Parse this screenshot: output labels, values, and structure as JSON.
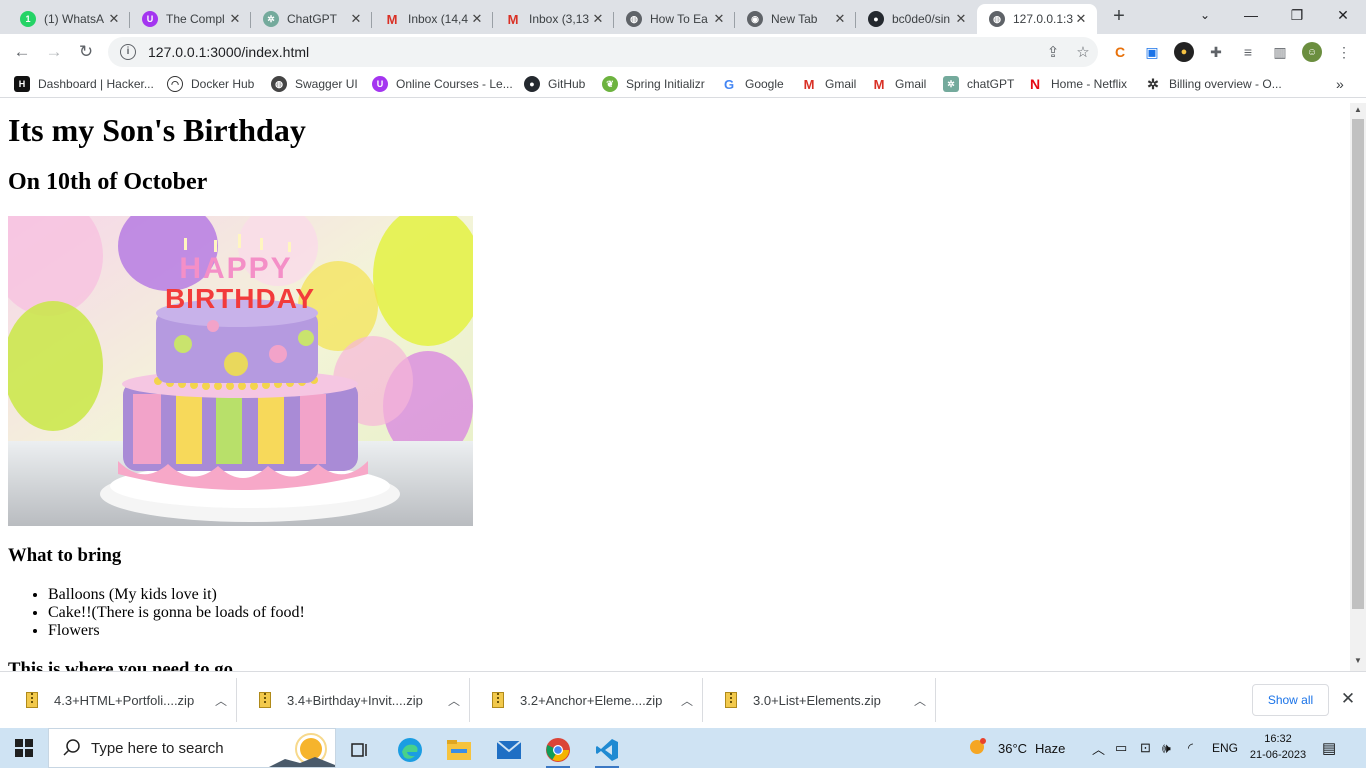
{
  "browser": {
    "tabs": [
      {
        "title": "(1) WhatsA",
        "icon": "whatsapp-icon"
      },
      {
        "title": "The Compl",
        "icon": "udemy-icon"
      },
      {
        "title": "ChatGPT",
        "icon": "openai-icon"
      },
      {
        "title": "Inbox (14,4",
        "icon": "gmail-icon"
      },
      {
        "title": "Inbox (3,13",
        "icon": "gmail-icon"
      },
      {
        "title": "How To Ea",
        "icon": "globe-icon"
      },
      {
        "title": "New Tab",
        "icon": "chrome-icon"
      },
      {
        "title": "bc0de0/sin",
        "icon": "github-icon"
      },
      {
        "title": "127.0.0.1:3",
        "icon": "globe-icon"
      }
    ],
    "address": "127.0.0.1:3000/index.html",
    "bookmarks": [
      {
        "label": "Dashboard | Hacker...",
        "icon": "hackerrank-icon"
      },
      {
        "label": "Docker Hub",
        "icon": "docker-icon"
      },
      {
        "label": "Swagger UI",
        "icon": "swagger-icon"
      },
      {
        "label": "Online Courses - Le...",
        "icon": "udemy-icon"
      },
      {
        "label": "GitHub",
        "icon": "github-icon"
      },
      {
        "label": "Spring Initializr",
        "icon": "spring-icon"
      },
      {
        "label": "Google",
        "icon": "google-icon"
      },
      {
        "label": "Gmail",
        "icon": "gmail-icon"
      },
      {
        "label": "Gmail",
        "icon": "gmail-icon"
      },
      {
        "label": "chatGPT",
        "icon": "openai-icon"
      },
      {
        "label": "Home - Netflix",
        "icon": "netflix-icon"
      },
      {
        "label": "Billing overview - O...",
        "icon": "openai-icon"
      }
    ]
  },
  "page": {
    "title": "Its my Son's Birthday",
    "date": "On 10th of October",
    "cake_text_top": "HAPPY",
    "cake_text_bottom": "BIRTHDAY",
    "bring_heading": "What to bring",
    "bring_items": [
      "Balloons (My kids love it)",
      "Cake!!(There is gonna be loads of food!",
      "Flowers"
    ],
    "where_heading": "This is where you need to go"
  },
  "downloads": {
    "items": [
      "4.3+HTML+Portfoli....zip",
      "3.4+Birthday+Invit....zip",
      "3.2+Anchor+Eleme....zip",
      "3.0+List+Elements.zip"
    ],
    "show_all": "Show all"
  },
  "taskbar": {
    "search_placeholder": "Type here to search",
    "weather_temp": "36°C",
    "weather_desc": "Haze",
    "language": "ENG",
    "time": "16:32",
    "date": "21-06-2023"
  }
}
